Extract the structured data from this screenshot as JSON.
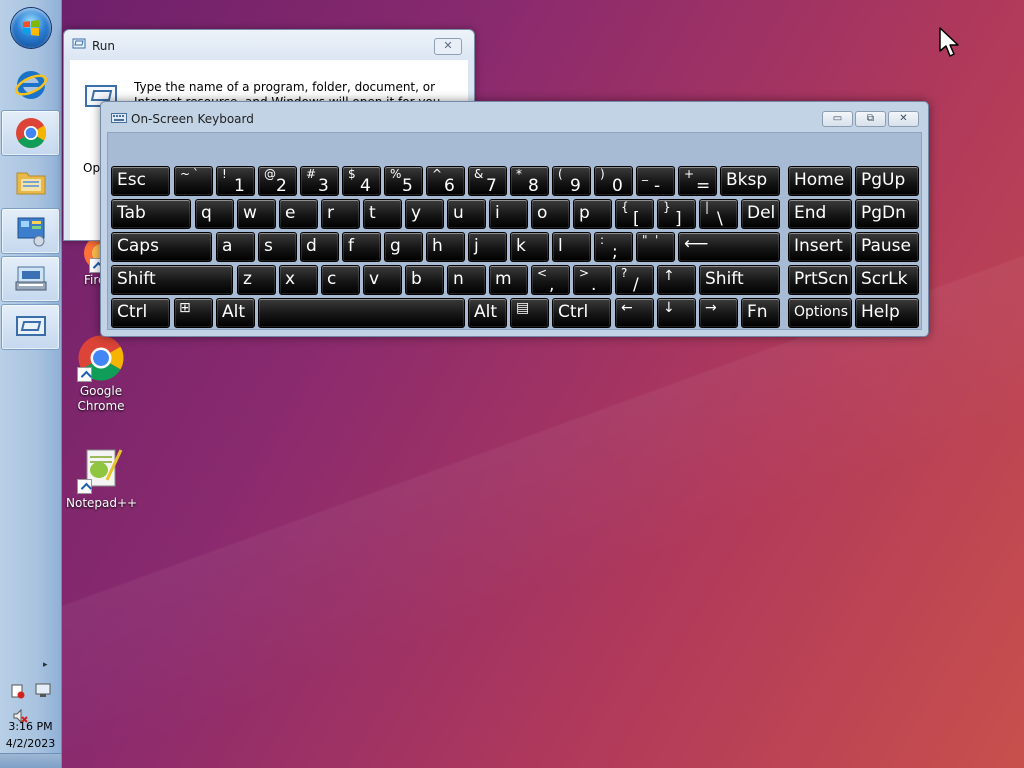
{
  "taskbar": {
    "start_icon": "windows-start-orb",
    "pinned": [
      {
        "name": "internet-explorer-icon"
      },
      {
        "name": "chrome-icon"
      },
      {
        "name": "file-explorer-icon"
      },
      {
        "name": "control-panel-icon"
      },
      {
        "name": "on-screen-keyboard-icon"
      },
      {
        "name": "run-dialog-icon"
      }
    ],
    "tray": {
      "chevron": "▸",
      "time": "3:16 PM",
      "date": "4/2/2023"
    }
  },
  "desktop": {
    "icons": [
      {
        "label": "Fire"
      },
      {
        "label": "Google Chrome"
      },
      {
        "label": "Notepad++"
      }
    ]
  },
  "run_dialog": {
    "title": "Run",
    "close": "✕",
    "description": "Type the name of a program, folder, document, or Internet resource, and Windows will open it for you.",
    "open_label": "Ope"
  },
  "osk": {
    "title": "On-Screen Keyboard",
    "minimize": "▭",
    "restore": "⧉",
    "close": "✕",
    "keys": {
      "esc": "Esc",
      "backtick_shift": "~",
      "backtick": "`",
      "k1s": "!",
      "k1": "1",
      "k2s": "@",
      "k2": "2",
      "k3s": "#",
      "k3": "3",
      "k4s": "$",
      "k4": "4",
      "k5s": "%",
      "k5": "5",
      "k6s": "^",
      "k6": "6",
      "k7s": "&",
      "k7": "7",
      "k8s": "*",
      "k8": "8",
      "k9s": "(",
      "k9": "9",
      "k0s": ")",
      "k0": "0",
      "minus_s": "_",
      "minus": "-",
      "plus_s": "+",
      "plus": "=",
      "bksp": "Bksp",
      "home": "Home",
      "pgup": "PgUp",
      "tab": "Tab",
      "q": "q",
      "w": "w",
      "e": "e",
      "r": "r",
      "t": "t",
      "y": "y",
      "u": "u",
      "i": "i",
      "o": "o",
      "p": "p",
      "lbr_s": "{",
      "lbr": "[",
      "rbr_s": "}",
      "rbr": "]",
      "bs_s": "|",
      "bs": "\\",
      "del": "Del",
      "end": "End",
      "pgdn": "PgDn",
      "caps": "Caps",
      "a": "a",
      "s": "s",
      "d": "d",
      "f": "f",
      "g": "g",
      "h": "h",
      "j": "j",
      "k": "k",
      "l": "l",
      "semi_s": ":",
      "semi": ";",
      "quote_s": "\"",
      "quote": "'",
      "enter": "⟵",
      "insert": "Insert",
      "pause": "Pause",
      "shift": "Shift",
      "z": "z",
      "x": "x",
      "c": "c",
      "v": "v",
      "b": "b",
      "n": "n",
      "m": "m",
      "comma_s": "<",
      "comma": ",",
      "period_s": ">",
      "period": ".",
      "slash_s": "?",
      "slash": "/",
      "up": "↑",
      "shift_r": "Shift",
      "prtscn": "PrtScn",
      "scrlk": "ScrLk",
      "ctrl": "Ctrl",
      "win": "⊞",
      "alt": "Alt",
      "alt_r": "Alt",
      "menu": "▤",
      "ctrl_r": "Ctrl",
      "left": "←",
      "down": "↓",
      "right": "→",
      "fn": "Fn",
      "options": "Options",
      "help": "Help"
    }
  },
  "colors": {
    "taskbar": "#a9c3e0",
    "desktop_start": "#6a1f6a",
    "desktop_end": "#c8504c",
    "key_face": "#151515",
    "osk_frame": "#c3d3e6"
  }
}
